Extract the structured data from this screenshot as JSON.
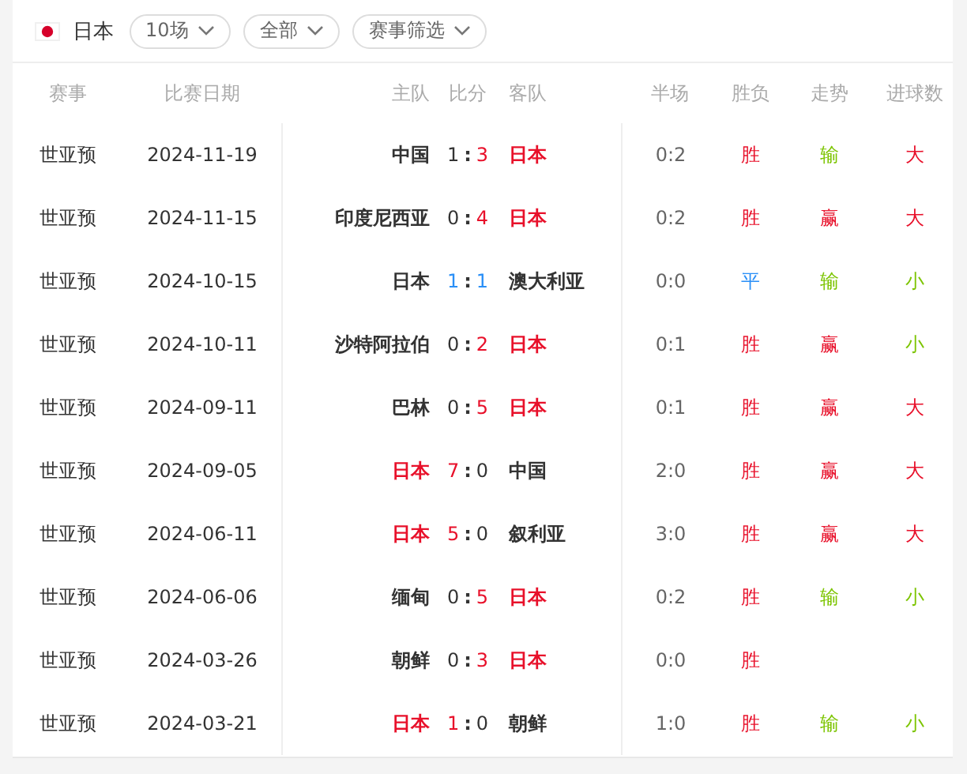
{
  "team": {
    "name": "日本"
  },
  "filters": [
    {
      "label": "10场"
    },
    {
      "label": "全部"
    },
    {
      "label": "赛事筛选"
    }
  ],
  "columns": {
    "league": "赛事",
    "date": "比赛日期",
    "home": "主队",
    "score": "比分",
    "away": "客队",
    "half": "半场",
    "result": "胜负",
    "trend": "走势",
    "goals": "进球数"
  },
  "rows": [
    {
      "league": "世亚预",
      "date": "2024-11-19",
      "separator": ":",
      "home": {
        "text": "中国",
        "color": "#333333"
      },
      "home_score": {
        "text": "1",
        "color": "#333333"
      },
      "away_score": {
        "text": "3",
        "color": "#e8102a"
      },
      "away": {
        "text": "日本",
        "color": "#e8102a"
      },
      "half": "0:2",
      "result": {
        "text": "胜",
        "color": "#e8102a"
      },
      "trend": {
        "text": "输",
        "color": "#7cc400"
      },
      "goals": {
        "text": "大",
        "color": "#e8102a"
      }
    },
    {
      "league": "世亚预",
      "date": "2024-11-15",
      "separator": ":",
      "home": {
        "text": "印度尼西亚",
        "color": "#333333"
      },
      "home_score": {
        "text": "0",
        "color": "#333333"
      },
      "away_score": {
        "text": "4",
        "color": "#e8102a"
      },
      "away": {
        "text": "日本",
        "color": "#e8102a"
      },
      "half": "0:2",
      "result": {
        "text": "胜",
        "color": "#e8102a"
      },
      "trend": {
        "text": "赢",
        "color": "#e8102a"
      },
      "goals": {
        "text": "大",
        "color": "#e8102a"
      }
    },
    {
      "league": "世亚预",
      "date": "2024-10-15",
      "separator": ":",
      "home": {
        "text": "日本",
        "color": "#333333"
      },
      "home_score": {
        "text": "1",
        "color": "#2a8ff7"
      },
      "away_score": {
        "text": "1",
        "color": "#2a8ff7"
      },
      "away": {
        "text": "澳大利亚",
        "color": "#333333"
      },
      "half": "0:0",
      "result": {
        "text": "平",
        "color": "#2a8ff7"
      },
      "trend": {
        "text": "输",
        "color": "#7cc400"
      },
      "goals": {
        "text": "小",
        "color": "#7cc400"
      }
    },
    {
      "league": "世亚预",
      "date": "2024-10-11",
      "separator": ":",
      "home": {
        "text": "沙特阿拉伯",
        "color": "#333333"
      },
      "home_score": {
        "text": "0",
        "color": "#333333"
      },
      "away_score": {
        "text": "2",
        "color": "#e8102a"
      },
      "away": {
        "text": "日本",
        "color": "#e8102a"
      },
      "half": "0:1",
      "result": {
        "text": "胜",
        "color": "#e8102a"
      },
      "trend": {
        "text": "赢",
        "color": "#e8102a"
      },
      "goals": {
        "text": "小",
        "color": "#7cc400"
      }
    },
    {
      "league": "世亚预",
      "date": "2024-09-11",
      "separator": ":",
      "home": {
        "text": "巴林",
        "color": "#333333"
      },
      "home_score": {
        "text": "0",
        "color": "#333333"
      },
      "away_score": {
        "text": "5",
        "color": "#e8102a"
      },
      "away": {
        "text": "日本",
        "color": "#e8102a"
      },
      "half": "0:1",
      "result": {
        "text": "胜",
        "color": "#e8102a"
      },
      "trend": {
        "text": "赢",
        "color": "#e8102a"
      },
      "goals": {
        "text": "大",
        "color": "#e8102a"
      }
    },
    {
      "league": "世亚预",
      "date": "2024-09-05",
      "separator": ":",
      "home": {
        "text": "日本",
        "color": "#e8102a"
      },
      "home_score": {
        "text": "7",
        "color": "#e8102a"
      },
      "away_score": {
        "text": "0",
        "color": "#333333"
      },
      "away": {
        "text": "中国",
        "color": "#333333"
      },
      "half": "2:0",
      "result": {
        "text": "胜",
        "color": "#e8102a"
      },
      "trend": {
        "text": "赢",
        "color": "#e8102a"
      },
      "goals": {
        "text": "大",
        "color": "#e8102a"
      }
    },
    {
      "league": "世亚预",
      "date": "2024-06-11",
      "separator": ":",
      "home": {
        "text": "日本",
        "color": "#e8102a"
      },
      "home_score": {
        "text": "5",
        "color": "#e8102a"
      },
      "away_score": {
        "text": "0",
        "color": "#333333"
      },
      "away": {
        "text": "叙利亚",
        "color": "#333333"
      },
      "half": "3:0",
      "result": {
        "text": "胜",
        "color": "#e8102a"
      },
      "trend": {
        "text": "赢",
        "color": "#e8102a"
      },
      "goals": {
        "text": "大",
        "color": "#e8102a"
      }
    },
    {
      "league": "世亚预",
      "date": "2024-06-06",
      "separator": ":",
      "home": {
        "text": "缅甸",
        "color": "#333333"
      },
      "home_score": {
        "text": "0",
        "color": "#333333"
      },
      "away_score": {
        "text": "5",
        "color": "#e8102a"
      },
      "away": {
        "text": "日本",
        "color": "#e8102a"
      },
      "half": "0:2",
      "result": {
        "text": "胜",
        "color": "#e8102a"
      },
      "trend": {
        "text": "输",
        "color": "#7cc400"
      },
      "goals": {
        "text": "小",
        "color": "#7cc400"
      }
    },
    {
      "league": "世亚预",
      "date": "2024-03-26",
      "separator": ":",
      "home": {
        "text": "朝鲜",
        "color": "#333333"
      },
      "home_score": {
        "text": "0",
        "color": "#333333"
      },
      "away_score": {
        "text": "3",
        "color": "#e8102a"
      },
      "away": {
        "text": "日本",
        "color": "#e8102a"
      },
      "half": "0:0",
      "result": {
        "text": "胜",
        "color": "#e8102a"
      }
    },
    {
      "league": "世亚预",
      "date": "2024-03-21",
      "separator": ":",
      "home": {
        "text": "日本",
        "color": "#e8102a"
      },
      "home_score": {
        "text": "1",
        "color": "#e8102a"
      },
      "away_score": {
        "text": "0",
        "color": "#333333"
      },
      "away": {
        "text": "朝鲜",
        "color": "#333333"
      },
      "half": "1:0",
      "result": {
        "text": "胜",
        "color": "#e8102a"
      },
      "trend": {
        "text": "输",
        "color": "#7cc400"
      },
      "goals": {
        "text": "小",
        "color": "#7cc400"
      }
    }
  ]
}
